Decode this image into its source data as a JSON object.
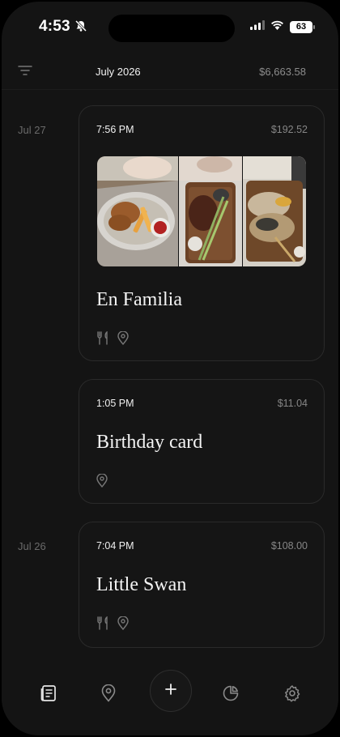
{
  "status_bar": {
    "time": "4:53",
    "battery": "63"
  },
  "header": {
    "month": "July 2026",
    "total": "$6,663.58"
  },
  "entries": [
    {
      "date": "Jul 27",
      "time": "7:56 PM",
      "amount": "$192.52",
      "title": "En Familia",
      "icons": [
        "fork-knife-icon",
        "location-pin-icon"
      ],
      "photo_count": 3
    },
    {
      "date": "",
      "time": "1:05 PM",
      "amount": "$11.04",
      "title": "Birthday card",
      "icons": [
        "location-pin-icon"
      ]
    },
    {
      "date": "Jul 26",
      "time": "7:04 PM",
      "amount": "$108.00",
      "title": "Little Swan",
      "icons": [
        "fork-knife-icon",
        "location-pin-icon"
      ]
    }
  ],
  "nav": {
    "items": [
      "journal-icon",
      "location-pin-icon",
      "plus-icon",
      "pie-chart-icon",
      "gear-icon"
    ],
    "active": "journal-icon"
  },
  "colors": {
    "background": "#141414",
    "card_border": "#2a2a2a",
    "text_primary": "#f4f4f4",
    "text_muted": "#868686"
  }
}
